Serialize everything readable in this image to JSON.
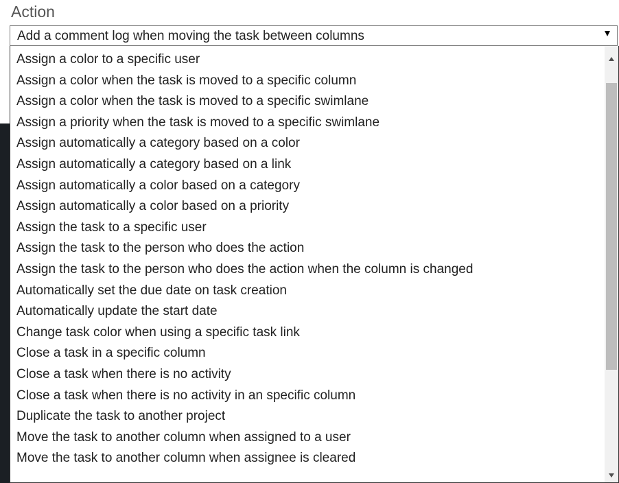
{
  "field": {
    "label": "Action"
  },
  "select": {
    "selected": "Add a comment log when moving the task between columns",
    "arrow_icon": "triangle-down-icon"
  },
  "options": [
    "Assign a color to a specific user",
    "Assign a color when the task is moved to a specific column",
    "Assign a color when the task is moved to a specific swimlane",
    "Assign a priority when the task is moved to a specific swimlane",
    "Assign automatically a category based on a color",
    "Assign automatically a category based on a link",
    "Assign automatically a color based on a category",
    "Assign automatically a color based on a priority",
    "Assign the task to a specific user",
    "Assign the task to the person who does the action",
    "Assign the task to the person who does the action when the column is changed",
    "Automatically set the due date on task creation",
    "Automatically update the start date",
    "Change task color when using a specific task link",
    "Close a task in a specific column",
    "Close a task when there is no activity",
    "Close a task when there is no activity in an specific column",
    "Duplicate the task to another project",
    "Move the task to another column when assigned to a user",
    "Move the task to another column when assignee is cleared"
  ],
  "scrollbar": {
    "up_icon": "scroll-up-arrow-icon",
    "down_icon": "scroll-down-arrow-icon"
  },
  "colors": {
    "text": "#222222",
    "label": "#555555",
    "thumb": "#bdbdbd",
    "track": "#f1f1f1"
  }
}
